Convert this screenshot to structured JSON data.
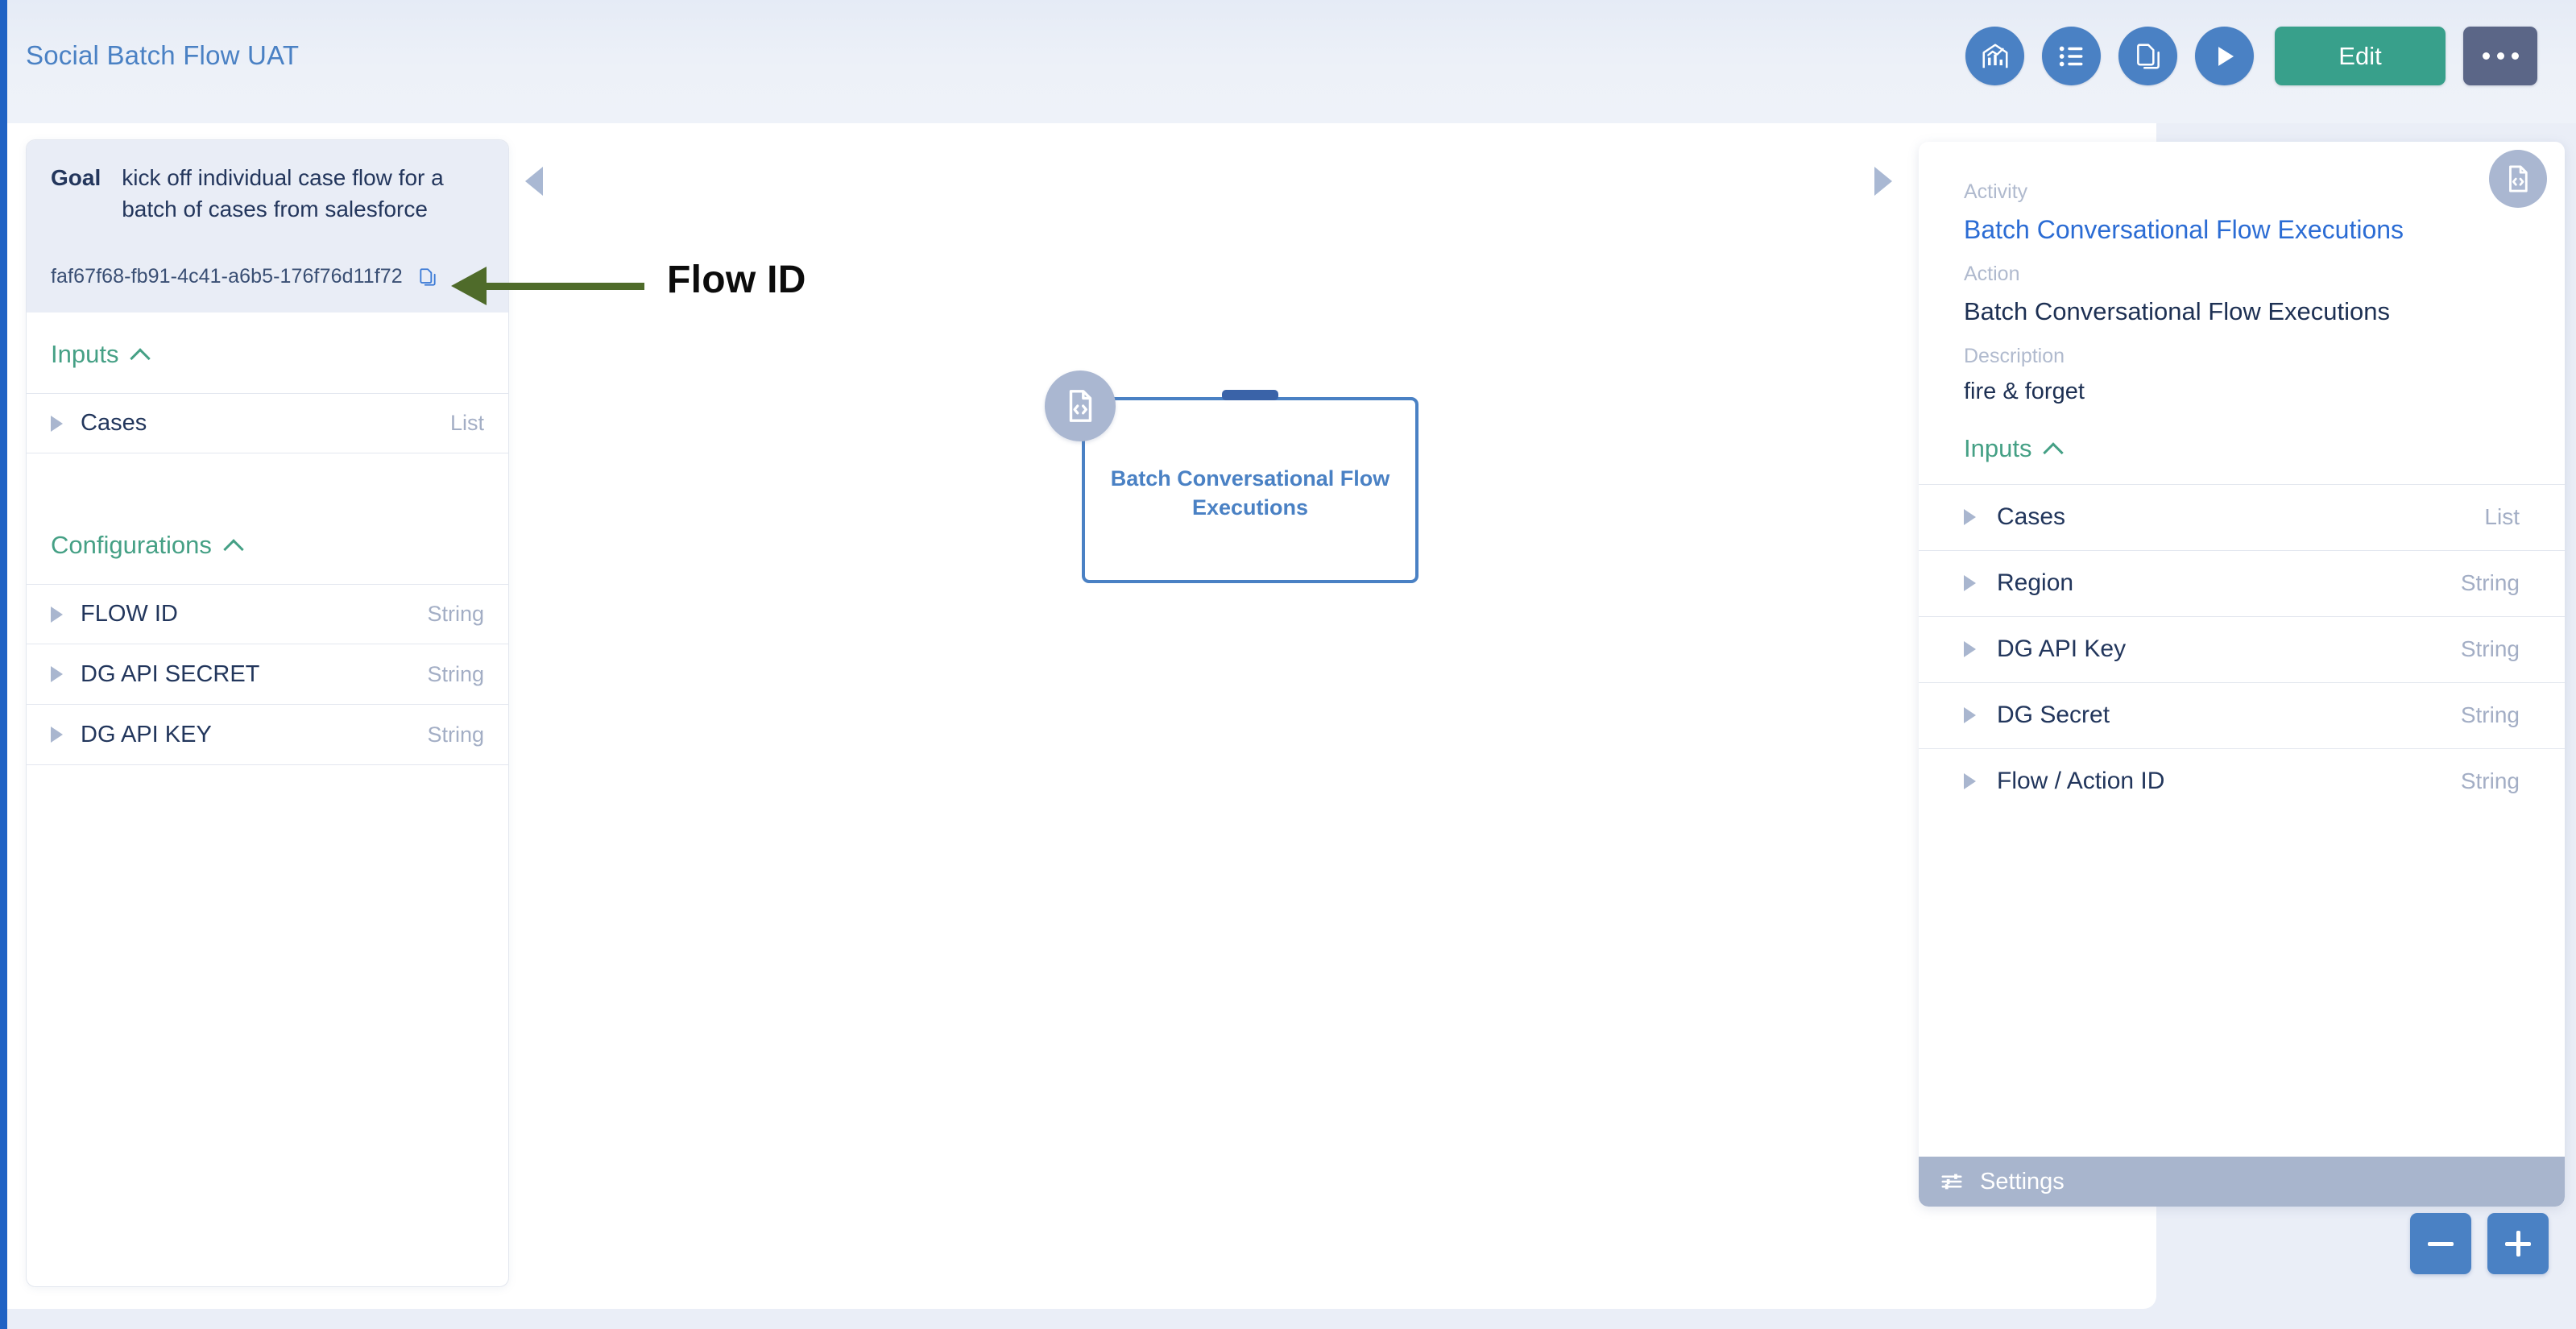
{
  "header": {
    "title": "Social Batch Flow UAT",
    "actions": [
      {
        "name": "analytics-icon",
        "label": "Analytics"
      },
      {
        "name": "list-icon",
        "label": "List"
      },
      {
        "name": "duplicate-icon",
        "label": "Duplicate"
      },
      {
        "name": "run-icon",
        "label": "Run"
      }
    ],
    "edit_label": "Edit",
    "more_label": "..."
  },
  "left_panel": {
    "goal_label": "Goal",
    "goal_text": "kick off individual case flow for a batch of cases from salesforce",
    "flow_id": "faf67f68-fb91-4c41-a6b5-176f76d11f72",
    "inputs_title": "Inputs",
    "inputs": [
      {
        "name": "Cases",
        "type": "List"
      }
    ],
    "configurations_title": "Configurations",
    "configurations": [
      {
        "name": "FLOW ID",
        "type": "String"
      },
      {
        "name": "DG API SECRET",
        "type": "String"
      },
      {
        "name": "DG API KEY",
        "type": "String"
      }
    ]
  },
  "canvas": {
    "node": {
      "label": "Batch Conversational Flow Executions"
    },
    "annotation": {
      "label": "Flow ID"
    },
    "zoom_out_label": "−",
    "zoom_in_label": "+"
  },
  "right_panel": {
    "activity_label": "Activity",
    "activity_value": "Batch Conversational Flow Executions",
    "action_label": "Action",
    "action_value": "Batch Conversational Flow Executions",
    "description_label": "Description",
    "description_value": "fire & forget",
    "inputs_title": "Inputs",
    "inputs": [
      {
        "name": "Cases",
        "type": "List"
      },
      {
        "name": "Region",
        "type": "String"
      },
      {
        "name": "DG API Key",
        "type": "String"
      },
      {
        "name": "DG Secret",
        "type": "String"
      },
      {
        "name": "Flow / Action ID",
        "type": "String"
      }
    ],
    "settings_label": "Settings"
  },
  "colors": {
    "brand_blue": "#4a81c4",
    "accent_green": "#38a08b",
    "section_green": "#45a085",
    "link_blue": "#2b6cd4",
    "annotation_green": "#4f6b2a",
    "rail_blue": "#1f62c4",
    "settings_bar": "#a8b5cd"
  }
}
